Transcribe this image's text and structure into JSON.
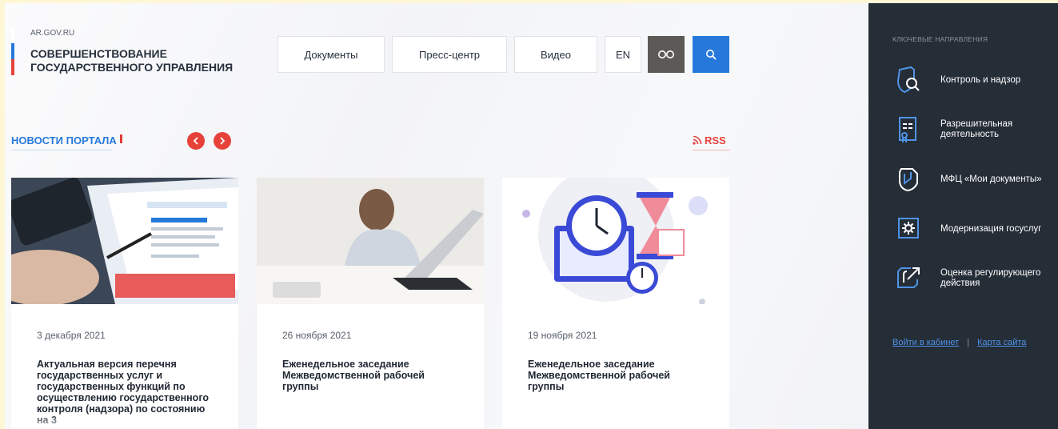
{
  "header": {
    "url": "AR.GOV.RU",
    "title_line1": "СОВЕРШЕНСТВОВАНИЕ",
    "title_line2": "ГОСУДАРСТВЕННОГО УПРАВЛЕНИЯ",
    "nav": [
      {
        "label": "Документы"
      },
      {
        "label": "Пресс-центр"
      },
      {
        "label": "Видео"
      },
      {
        "label": "EN"
      }
    ],
    "accessibility_icon": "glasses-icon",
    "search_icon": "search-icon"
  },
  "news": {
    "title": "НОВОСТИ ПОРТАЛА",
    "rss_label": "RSS",
    "cards": [
      {
        "date": "3 декабря 2021",
        "text": "Актуальная версия перечня государственных услуг и государственных функций по осуществлению государственного контроля (надзора) по состоянию на 3"
      },
      {
        "date": "26 ноября 2021",
        "text": "Еженедельное заседание Межведомственной рабочей группы"
      },
      {
        "date": "19 ноября 2021",
        "text": "Еженедельное заседание Межведомственной рабочей группы"
      }
    ]
  },
  "sidebar": {
    "heading": "КЛЮЧЕВЫЕ НАПРАВЛЕНИЯ",
    "items": [
      {
        "label": "Контроль и надзор",
        "icon": "shield-search-icon"
      },
      {
        "label": "Разрешительная деятельность",
        "icon": "license-document-icon"
      },
      {
        "label": "МФЦ «Мои документы»",
        "icon": "mfc-hand-icon"
      },
      {
        "label": "Модернизация госуслуг",
        "icon": "gear-screen-icon"
      },
      {
        "label": "Оценка регулирующего действия",
        "icon": "arrow-out-icon"
      }
    ],
    "login_link": "Войти в кабинет",
    "separator": "|",
    "sitemap_link": "Карта сайта"
  },
  "colors": {
    "accent_blue": "#2679db",
    "accent_red": "#e6423a",
    "sidebar_bg": "#252d37"
  }
}
